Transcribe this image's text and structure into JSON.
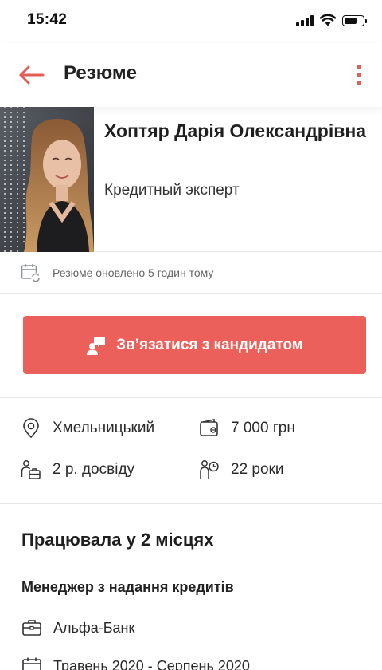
{
  "status_bar": {
    "time": "15:42",
    "icons": [
      "signal-icon",
      "wifi-icon",
      "battery-icon"
    ],
    "battery_level": 0.7
  },
  "header": {
    "title": "Резюме",
    "back_icon": "arrow-left-icon",
    "menu_icon": "more-vertical-icon",
    "accent_color": "#e25d55"
  },
  "profile": {
    "name": "Хоптяр Дарія Олександрівна",
    "position": "Кредитный эксперт"
  },
  "updated": {
    "icon": "calendar-refresh-icon",
    "text": "Резюме оновлено 5 годин тому"
  },
  "contact": {
    "label": "Зв’язатися з кандидатом",
    "icon": "chat-user-icon",
    "color": "#eb605b"
  },
  "facts": {
    "city": "Хмельницький",
    "salary": "7 000 грн",
    "experience": "2 р. досвіду",
    "age": "22 роки"
  },
  "experience": {
    "title": "Працювала у 2 місцях",
    "jobs": [
      {
        "title": "Менеджер з надання кредитів",
        "company": "Альфа-Банк",
        "period": "Травень 2020 - Серпень 2020"
      }
    ]
  }
}
